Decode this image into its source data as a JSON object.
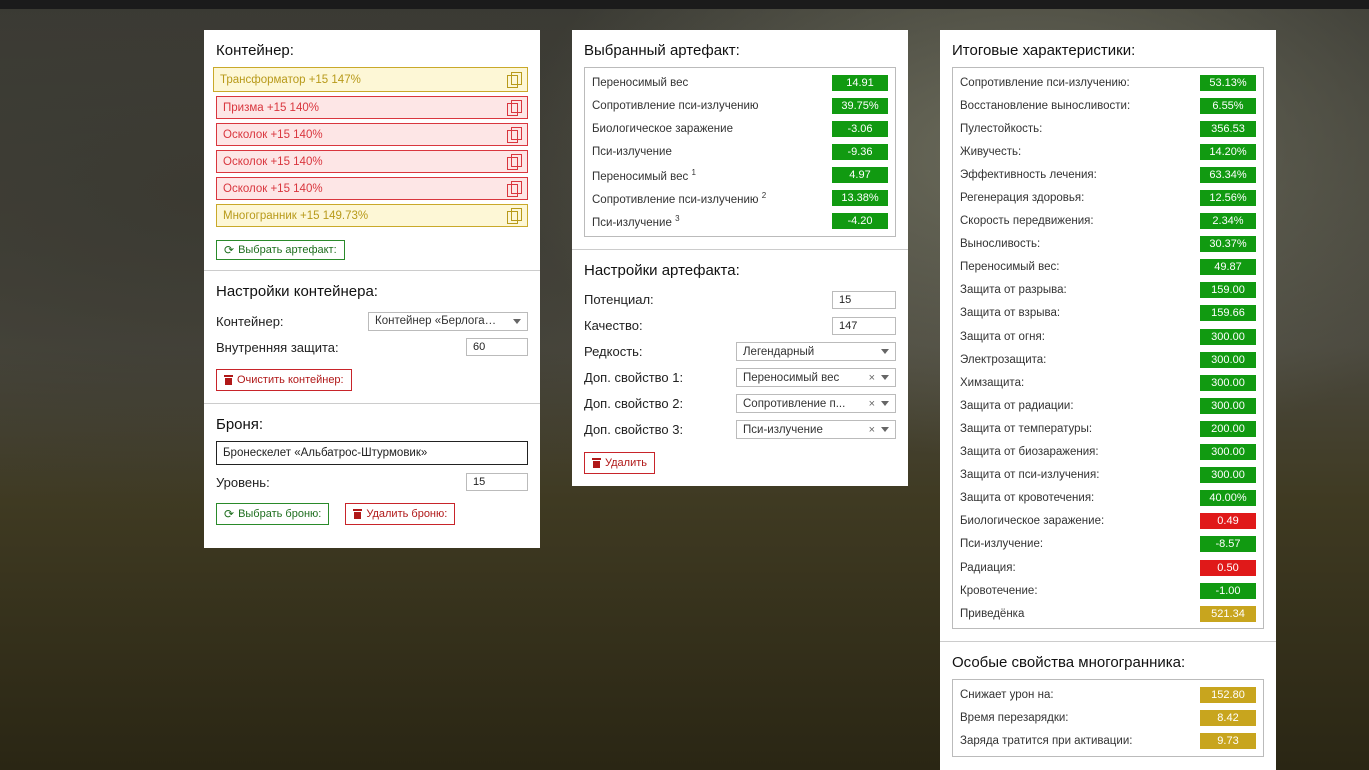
{
  "container_panel": {
    "title": "Контейнер:",
    "artifacts": [
      {
        "label": "Трансформатор +15 147%",
        "rarity": "legendary"
      },
      {
        "label": "Призма +15 140%",
        "rarity": "red"
      },
      {
        "label": "Осколок +15 140%",
        "rarity": "red"
      },
      {
        "label": "Осколок +15 140%",
        "rarity": "red"
      },
      {
        "label": "Осколок +15 140%",
        "rarity": "red"
      },
      {
        "label": "Многогранник +15 149.73%",
        "rarity": "legendary"
      }
    ],
    "select_artifact_label": "Выбрать артефакт:",
    "settings_title": "Настройки контейнера:",
    "container_label": "Контейнер:",
    "container_value": "Контейнер «Берлога…",
    "inner_protection_label": "Внутренняя защита:",
    "inner_protection_value": "60",
    "clear_container_label": "Очистить контейнер:",
    "armor_title": "Броня:",
    "armor_value": "Бронескелет «Альбатрос-Штурмовик»",
    "level_label": "Уровень:",
    "level_value": "15",
    "select_armor_label": "Выбрать броню:",
    "delete_armor_label": "Удалить броню:"
  },
  "artifact_panel": {
    "title": "Выбранный артефакт:",
    "stats": [
      {
        "label": "Переносимый вес",
        "sup": "",
        "value": "14.91",
        "color": "green"
      },
      {
        "label": "Сопротивление пси-излучению",
        "sup": "",
        "value": "39.75%",
        "color": "green"
      },
      {
        "label": "Биологическое заражение",
        "sup": "",
        "value": "-3.06",
        "color": "green"
      },
      {
        "label": "Пси-излучение",
        "sup": "",
        "value": "-9.36",
        "color": "green"
      },
      {
        "label": "Переносимый вес",
        "sup": "1",
        "value": "4.97",
        "color": "green"
      },
      {
        "label": "Сопротивление пси-излучению",
        "sup": "2",
        "value": "13.38%",
        "color": "green"
      },
      {
        "label": "Пси-излучение",
        "sup": "3",
        "value": "-4.20",
        "color": "green"
      }
    ],
    "settings_title": "Настройки артефакта:",
    "potential_label": "Потенциал:",
    "potential_value": "15",
    "quality_label": "Качество:",
    "quality_value": "147",
    "rarity_label": "Редкость:",
    "rarity_value": "Легендарный",
    "extra1_label": "Доп. свойство 1:",
    "extra1_value": "Переносимый вес",
    "extra2_label": "Доп. свойство 2:",
    "extra2_value": "Сопротивление п...",
    "extra3_label": "Доп. свойство 3:",
    "extra3_value": "Пси-излучение",
    "clear_x": "×",
    "delete_label": "Удалить"
  },
  "totals_panel": {
    "title": "Итоговые характеристики:",
    "stats": [
      {
        "label": "Сопротивление пси-излучению:",
        "value": "53.13%",
        "color": "green"
      },
      {
        "label": "Восстановление выносливости:",
        "value": "6.55%",
        "color": "green"
      },
      {
        "label": "Пулестойкость:",
        "value": "356.53",
        "color": "green"
      },
      {
        "label": "Живучесть:",
        "value": "14.20%",
        "color": "green"
      },
      {
        "label": "Эффективность лечения:",
        "value": "63.34%",
        "color": "green"
      },
      {
        "label": "Регенерация здоровья:",
        "value": "12.56%",
        "color": "green"
      },
      {
        "label": "Скорость передвижения:",
        "value": "2.34%",
        "color": "green"
      },
      {
        "label": "Выносливость:",
        "value": "30.37%",
        "color": "green"
      },
      {
        "label": "Переносимый вес:",
        "value": "49.87",
        "color": "green"
      },
      {
        "label": "Защита от разрыва:",
        "value": "159.00",
        "color": "green"
      },
      {
        "label": "Защита от взрыва:",
        "value": "159.66",
        "color": "green"
      },
      {
        "label": "Защита от огня:",
        "value": "300.00",
        "color": "green"
      },
      {
        "label": "Электрозащита:",
        "value": "300.00",
        "color": "green"
      },
      {
        "label": "Химзащита:",
        "value": "300.00",
        "color": "green"
      },
      {
        "label": "Защита от радиации:",
        "value": "300.00",
        "color": "green"
      },
      {
        "label": "Защита от температуры:",
        "value": "200.00",
        "color": "green"
      },
      {
        "label": "Защита от биозаражения:",
        "value": "300.00",
        "color": "green"
      },
      {
        "label": "Защита от пси-излучения:",
        "value": "300.00",
        "color": "green"
      },
      {
        "label": "Защита от кровотечения:",
        "value": "40.00%",
        "color": "green"
      },
      {
        "label": "Биологическое заражение:",
        "value": "0.49",
        "color": "red"
      },
      {
        "label": "Пси-излучение:",
        "value": "-8.57",
        "color": "green"
      },
      {
        "label": "Радиация:",
        "value": "0.50",
        "color": "red"
      },
      {
        "label": "Кровотечение:",
        "value": "-1.00",
        "color": "green"
      },
      {
        "label": "Приведёнка",
        "value": "521.34",
        "color": "yellow"
      }
    ],
    "special_title": "Особые свойства многогранника:",
    "special": [
      {
        "label": "Снижает урон на:",
        "value": "152.80",
        "color": "yellow"
      },
      {
        "label": "Время перезарядки:",
        "value": "8.42",
        "color": "yellow"
      },
      {
        "label": "Заряда тратится при активации:",
        "value": "9.73",
        "color": "yellow"
      }
    ]
  }
}
